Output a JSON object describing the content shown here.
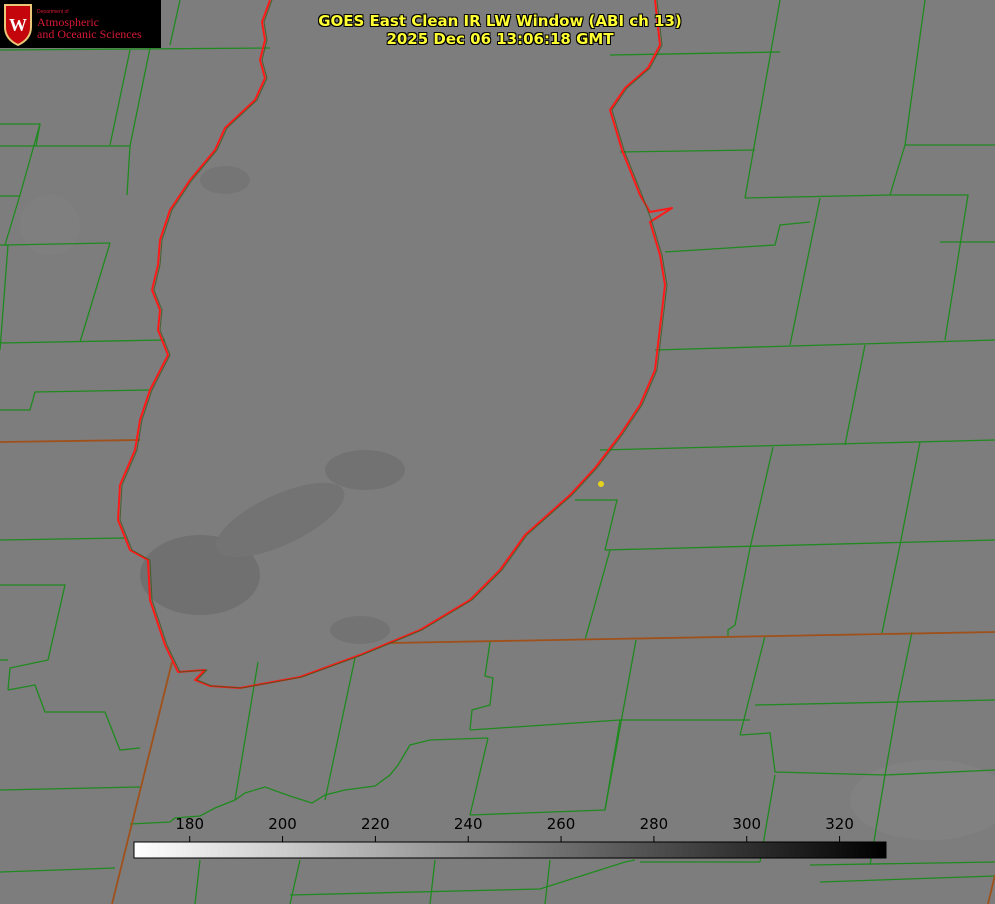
{
  "title": {
    "line1": "GOES East Clean IR LW Window (ABI ch 13)",
    "line2": "2025 Dec 06 13:06:18 GMT"
  },
  "logo": {
    "dept": "Department of",
    "line1": "Atmospheric",
    "line2": "and Oceanic Sciences",
    "crest_letter": "W",
    "color": "#d71935"
  },
  "colorbar": {
    "min": 168,
    "max": 330,
    "min_color": "#ffffff",
    "max_color": "#000000",
    "ticks": [
      {
        "value": 180,
        "label": "180"
      },
      {
        "value": 200,
        "label": "200"
      },
      {
        "value": 220,
        "label": "220"
      },
      {
        "value": 240,
        "label": "240"
      },
      {
        "value": 260,
        "label": "260"
      },
      {
        "value": 280,
        "label": "280"
      },
      {
        "value": 300,
        "label": "300"
      },
      {
        "value": 320,
        "label": "320"
      }
    ]
  },
  "colors": {
    "background": "#7d7d7d",
    "county_lines": "#1f8a1f",
    "state_lines": "#8a4a1a",
    "lake_shore": "#ff2020",
    "title_text": "#ffff33",
    "marker": "#e6d21e"
  }
}
